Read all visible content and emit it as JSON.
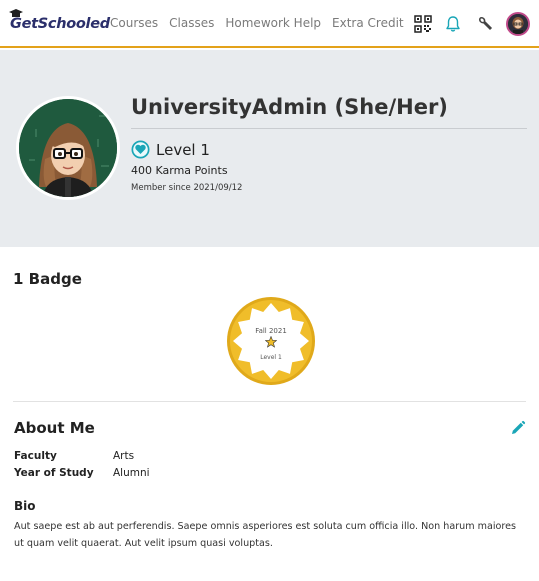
{
  "header": {
    "logo_text": "GetSchooled",
    "nav": [
      "Courses",
      "Classes",
      "Homework Help",
      "Extra Credit"
    ],
    "icons": [
      "qr-code-icon",
      "bell-icon",
      "wrench-icon",
      "user-avatar"
    ],
    "accent_color": "#e3a21a",
    "icon_color": "#1aa6b7"
  },
  "profile": {
    "name": "UniversityAdmin (She/Her)",
    "level": "Level 1",
    "karma": "400 Karma Points",
    "member_since": "Member since 2021/09/12",
    "banner_color": "#e8ebee"
  },
  "badges": {
    "heading": "1 Badge",
    "items": [
      {
        "term": "Fall 2021",
        "level": "Level 1",
        "color": "#e0a91a"
      }
    ]
  },
  "about": {
    "heading": "About Me",
    "fields": [
      {
        "label": "Faculty",
        "value": "Arts"
      },
      {
        "label": "Year of Study",
        "value": "Alumni"
      }
    ],
    "bio_heading": "Bio",
    "bio_text": "Aut saepe est ab aut perferendis. Saepe omnis asperiores est soluta cum officia illo. Non harum maiores ut quam velit quaerat. Aut velit ipsum quasi voluptas.",
    "edit_icon_color": "#1aa6b7"
  }
}
